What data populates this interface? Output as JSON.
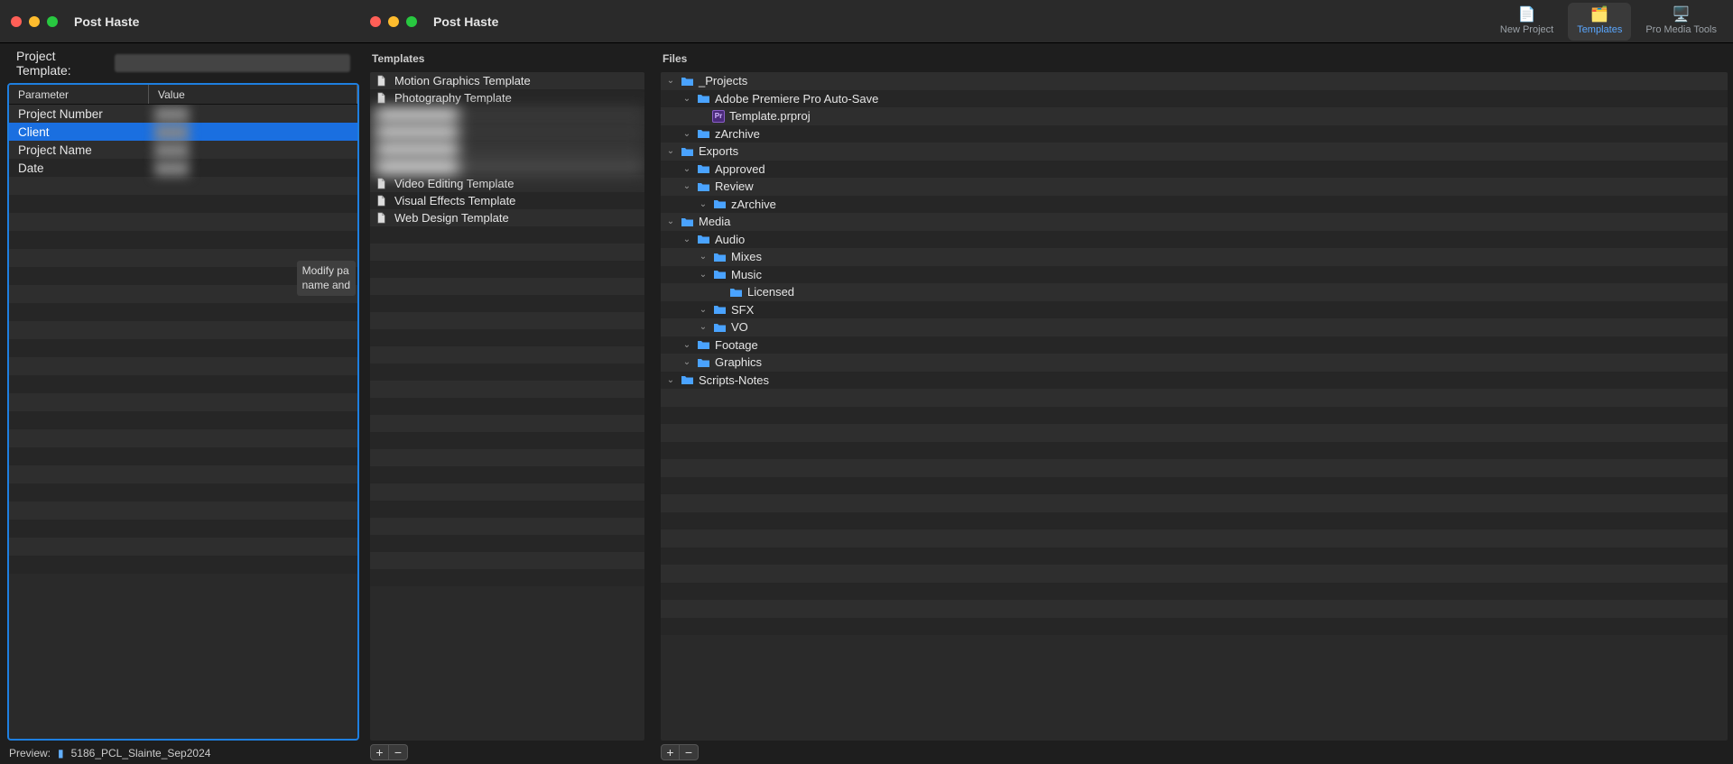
{
  "titlebar": {
    "title_left": "Post Haste",
    "title_mid": "Post Haste"
  },
  "toolbar": {
    "new_project": "New Project",
    "templates": "Templates",
    "pro_media_tools": "Pro Media Tools"
  },
  "project_template": {
    "label": "Project Template:"
  },
  "param_table": {
    "header_parameter": "Parameter",
    "header_value": "Value",
    "rows": [
      {
        "name": "Project Number",
        "value": ""
      },
      {
        "name": "Client",
        "value": ""
      },
      {
        "name": "Project Name",
        "value": ""
      },
      {
        "name": "Date",
        "value": ""
      }
    ],
    "selected_index": 1,
    "tooltip": "Modify pa\nname and"
  },
  "preview": {
    "label": "Preview:",
    "folder_name": "5186_PCL_Slainte_Sep2024"
  },
  "templates_panel": {
    "header": "Templates",
    "items": [
      {
        "label": "Motion Graphics Template",
        "blurred": false
      },
      {
        "label": "Photography Template",
        "blurred": false
      },
      {
        "label": "",
        "blurred": true
      },
      {
        "label": "",
        "blurred": true
      },
      {
        "label": "",
        "blurred": true
      },
      {
        "label": "",
        "blurred": true,
        "selected": true
      },
      {
        "label": "Video Editing Template",
        "blurred": false
      },
      {
        "label": "Visual Effects Template",
        "blurred": false
      },
      {
        "label": "Web Design Template",
        "blurred": false
      }
    ]
  },
  "files_panel": {
    "header": "Files",
    "tree": [
      {
        "depth": 0,
        "expanded": true,
        "type": "folder",
        "name": "_Projects"
      },
      {
        "depth": 1,
        "expanded": true,
        "type": "folder",
        "name": "Adobe Premiere Pro Auto-Save"
      },
      {
        "depth": 2,
        "expanded": null,
        "type": "file-pr",
        "name": "Template.prproj"
      },
      {
        "depth": 1,
        "expanded": true,
        "type": "folder",
        "name": "zArchive"
      },
      {
        "depth": 0,
        "expanded": true,
        "type": "folder",
        "name": "Exports"
      },
      {
        "depth": 1,
        "expanded": true,
        "type": "folder",
        "name": "Approved"
      },
      {
        "depth": 1,
        "expanded": true,
        "type": "folder",
        "name": "Review"
      },
      {
        "depth": 2,
        "expanded": true,
        "type": "folder",
        "name": "zArchive"
      },
      {
        "depth": 0,
        "expanded": true,
        "type": "folder",
        "name": "Media"
      },
      {
        "depth": 1,
        "expanded": true,
        "type": "folder",
        "name": "Audio"
      },
      {
        "depth": 2,
        "expanded": true,
        "type": "folder",
        "name": "Mixes"
      },
      {
        "depth": 2,
        "expanded": true,
        "type": "folder",
        "name": "Music"
      },
      {
        "depth": 3,
        "expanded": null,
        "type": "folder",
        "name": "Licensed"
      },
      {
        "depth": 2,
        "expanded": true,
        "type": "folder",
        "name": "SFX"
      },
      {
        "depth": 2,
        "expanded": true,
        "type": "folder",
        "name": "VO"
      },
      {
        "depth": 1,
        "expanded": true,
        "type": "folder",
        "name": "Footage"
      },
      {
        "depth": 1,
        "expanded": true,
        "type": "folder",
        "name": "Graphics"
      },
      {
        "depth": 0,
        "expanded": true,
        "type": "folder",
        "name": "Scripts-Notes"
      }
    ]
  }
}
